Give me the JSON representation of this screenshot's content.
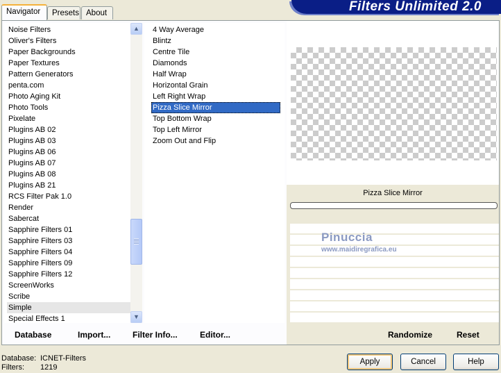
{
  "window": {
    "title": "Filters Unlimited 2.0"
  },
  "tabs": [
    {
      "label": "Navigator",
      "active": true
    },
    {
      "label": "Presets",
      "active": false
    },
    {
      "label": "About",
      "active": false
    }
  ],
  "categories": {
    "items": [
      "Noise Filters",
      "Oliver's Filters",
      "Paper Backgrounds",
      "Paper Textures",
      "Pattern Generators",
      "penta.com",
      "Photo Aging Kit",
      "Photo Tools",
      "Pixelate",
      "Plugins AB 02",
      "Plugins AB 03",
      "Plugins AB 06",
      "Plugins AB 07",
      "Plugins AB 08",
      "Plugins AB 21",
      "RCS Filter Pak 1.0",
      "Render",
      "Sabercat",
      "Sapphire Filters 01",
      "Sapphire Filters 03",
      "Sapphire Filters 04",
      "Sapphire Filters 09",
      "Sapphire Filters 12",
      "ScreenWorks",
      "Scribe",
      "Simple",
      "Special Effects 1"
    ],
    "selected": "Simple"
  },
  "filters": {
    "items": [
      "4 Way Average",
      "Blintz",
      "Centre Tile",
      "Diamonds",
      "Half Wrap",
      "Horizontal Grain",
      "Left Right Wrap",
      "Pizza Slice Mirror",
      "Top Bottom Wrap",
      "Top Left Mirror",
      "Zoom Out and Flip"
    ],
    "selected": "Pizza Slice Mirror"
  },
  "preview": {
    "filter_name": "Pizza Slice Mirror",
    "watermark": "Pinuccia",
    "watermark_url": "www.maidiregrafica.eu"
  },
  "links": {
    "database": "Database",
    "import": "Import...",
    "filter_info": "Filter Info...",
    "editor": "Editor...",
    "randomize": "Randomize",
    "reset": "Reset"
  },
  "footer": {
    "database_label": "Database:",
    "database_value": "ICNET-Filters",
    "filters_label": "Filters:",
    "filters_value": "1219"
  },
  "buttons": {
    "apply": "Apply",
    "cancel": "Cancel",
    "help": "Help"
  },
  "scroll": {
    "up_icon": "arrow-up-icon",
    "down_icon": "arrow-down-icon",
    "position": 0.68
  }
}
